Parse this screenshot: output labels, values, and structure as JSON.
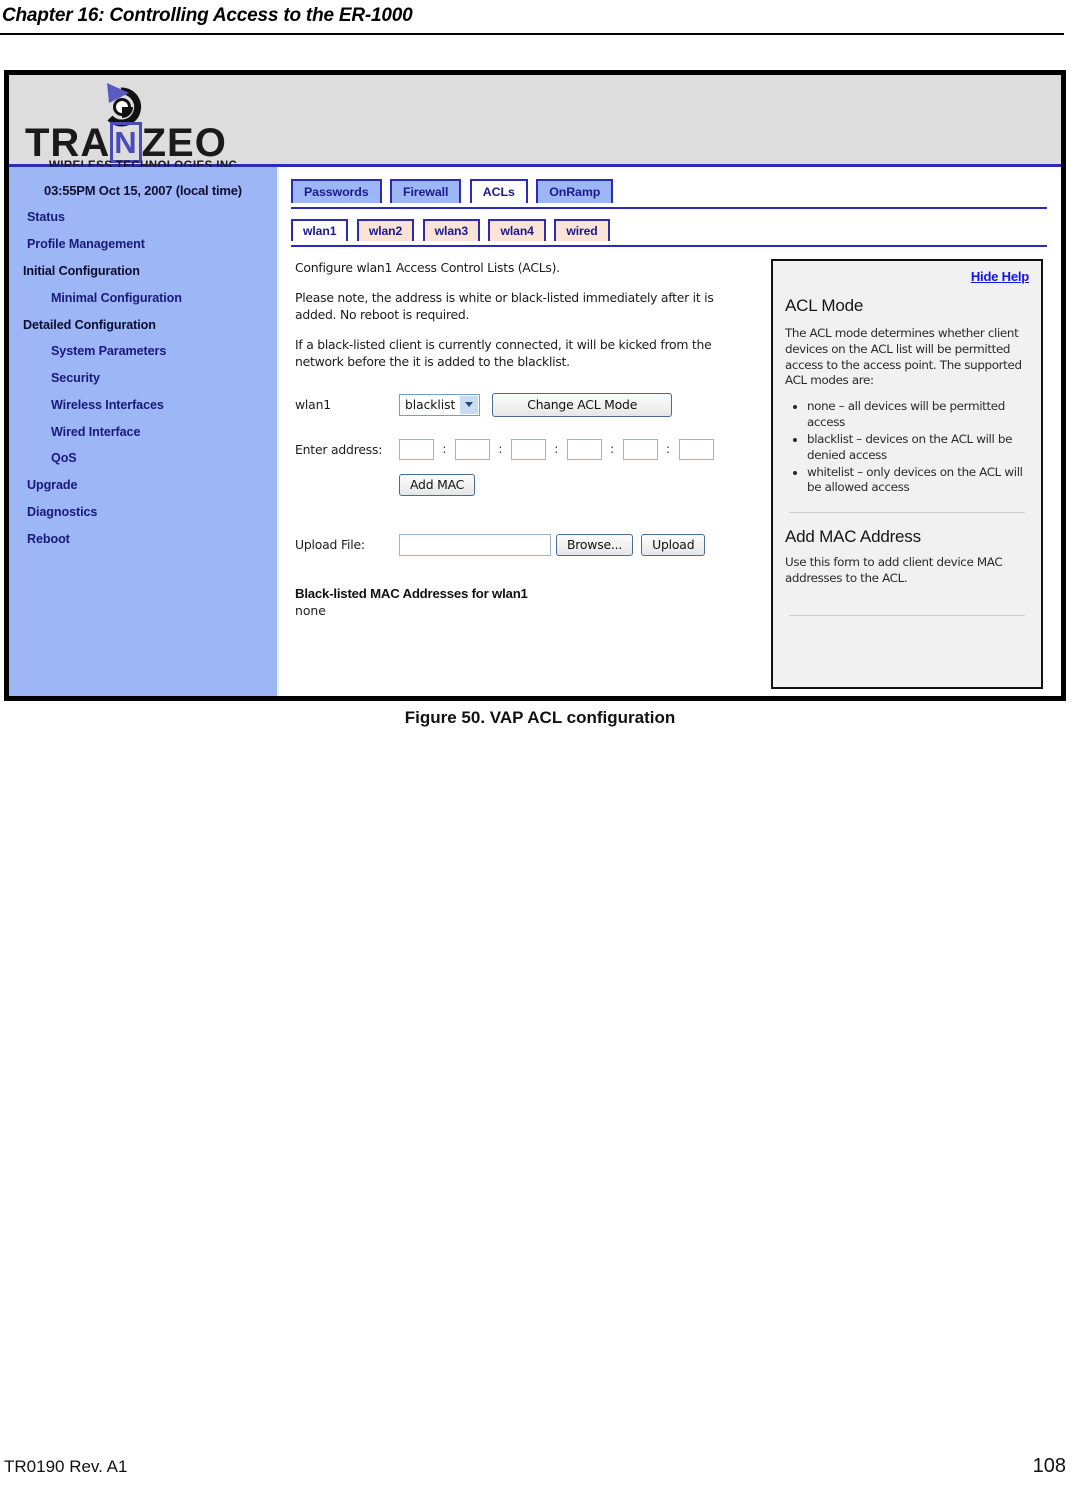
{
  "document": {
    "running_header": "Chapter 16: Controlling Access to the ER-1000",
    "figure_caption": "Figure 50. VAP ACL configuration",
    "footer_left": "TR0190 Rev. A1",
    "footer_page": "108"
  },
  "brand": {
    "name_part1": "TRA",
    "name_n": "N",
    "name_part2": "ZEO",
    "tagline": "WIRELESS  TECHNOLOGIES INC.",
    "accent_color": "#4a4ab8"
  },
  "sidebar": {
    "clock": "03:55PM Oct 15, 2007 (local time)",
    "items": [
      {
        "label": "Status",
        "level": "link"
      },
      {
        "label": "Profile Management",
        "level": "link"
      },
      {
        "label": "Initial Configuration",
        "level": "section"
      },
      {
        "label": "Minimal Configuration",
        "level": "sub"
      },
      {
        "label": "Detailed Configuration",
        "level": "section"
      },
      {
        "label": "System Parameters",
        "level": "sub"
      },
      {
        "label": "Security",
        "level": "sub"
      },
      {
        "label": "Wireless Interfaces",
        "level": "sub"
      },
      {
        "label": "Wired Interface",
        "level": "sub"
      },
      {
        "label": "QoS",
        "level": "sub"
      },
      {
        "label": "Upgrade",
        "level": "link"
      },
      {
        "label": "Diagnostics",
        "level": "link"
      },
      {
        "label": "Reboot",
        "level": "link"
      }
    ]
  },
  "tabs_primary": [
    {
      "label": "Passwords",
      "active": false
    },
    {
      "label": "Firewall",
      "active": false
    },
    {
      "label": "ACLs",
      "active": true
    },
    {
      "label": "OnRamp",
      "active": false
    }
  ],
  "tabs_secondary": [
    {
      "label": "wlan1",
      "active": true
    },
    {
      "label": "wlan2",
      "active": false
    },
    {
      "label": "wlan3",
      "active": false
    },
    {
      "label": "wlan4",
      "active": false
    },
    {
      "label": "wired",
      "active": false
    }
  ],
  "main": {
    "intro": "Configure wlan1 Access Control Lists (ACLs).",
    "note1": "Please note, the address is white or black-listed immediately after it is added. No reboot is required.",
    "note2": "If a black-listed client is currently connected, it will be kicked from the network before the it is added to the blacklist.",
    "acl_mode_label": "wlan1",
    "acl_mode_value": "blacklist",
    "acl_mode_options": [
      "none",
      "blacklist",
      "whitelist"
    ],
    "change_mode_button": "Change ACL Mode",
    "enter_address_label": "Enter address:",
    "mac_octets": [
      "",
      "",
      "",
      "",
      "",
      ""
    ],
    "mac_separator": ":",
    "add_mac_button": "Add MAC",
    "upload_file_label": "Upload File:",
    "upload_file_value": "",
    "browse_button": "Browse...",
    "upload_button": "Upload",
    "list_heading": "Black-listed MAC Addresses for wlan1",
    "list_value": "none"
  },
  "help": {
    "hide_link": "Hide Help",
    "section1_title": "ACL Mode",
    "section1_body": "The ACL mode determines whether client devices on the ACL list will be permitted access to the access point. The supported ACL modes are:",
    "section1_bullets": [
      "none – all devices will be permitted access",
      "blacklist – devices on the ACL will be denied access",
      "whitelist – only devices on the ACL will be allowed access"
    ],
    "section2_title": "Add MAC Address",
    "section2_body": "Use this form to add client device MAC addresses to the ACL."
  }
}
